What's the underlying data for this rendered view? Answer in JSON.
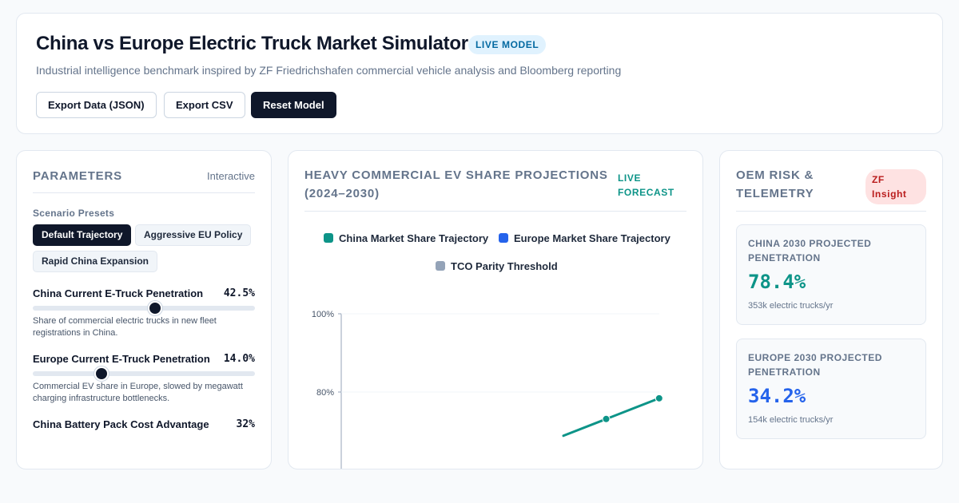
{
  "header": {
    "title": "China vs Europe Electric Truck Market Simulator",
    "badge": "LIVE MODEL",
    "subtitle": "Industrial intelligence benchmark inspired by ZF Friedrichshafen commercial vehicle analysis and Bloomberg reporting",
    "buttons": {
      "export_json": "Export Data (JSON)",
      "export_csv": "Export CSV",
      "reset": "Reset Model"
    }
  },
  "parameters": {
    "title": "Parameters",
    "mode": "Interactive",
    "presets_label": "Scenario Presets",
    "presets": [
      "Default Trajectory",
      "Aggressive EU Policy",
      "Rapid China Expansion"
    ],
    "active_preset": "Default Trajectory",
    "items": [
      {
        "label": "China Current E-Truck Penetration",
        "value": "42.5%",
        "level": 0.55,
        "description": "Share of commercial electric trucks in new fleet registrations in China."
      },
      {
        "label": "Europe Current E-Truck Penetration",
        "value": "14.0%",
        "level": 0.31,
        "description": "Commercial EV share in Europe, slowed by megawatt charging infrastructure bottlenecks."
      },
      {
        "label": "China Battery Pack Cost Advantage",
        "value": "32%"
      }
    ]
  },
  "chart_panel": {
    "title": "Heavy Commercial EV Share Projections (2024–2030)",
    "badge": "LIVE FORECAST"
  },
  "chart_data": {
    "type": "line",
    "title": "Heavy Commercial EV Share Projections (2024–2030)",
    "legend": [
      "China Market Share Trajectory",
      "Europe Market Share Trajectory",
      "TCO Parity Threshold"
    ],
    "legend_placement": "top",
    "y_ticks": [
      "100%",
      "80%"
    ],
    "ylim": [
      0,
      100
    ],
    "grid": true,
    "colors": {
      "china": "#0d9488",
      "europe": "#2563eb",
      "tco": "#94a3b8"
    },
    "series": [
      {
        "name": "China Market Share Trajectory",
        "visible_points": [
          {
            "index": 5,
            "y": 73.1
          },
          {
            "index": 6,
            "y": 78.4
          }
        ]
      }
    ]
  },
  "risk_panel": {
    "title": "OEM Risk & Telemetry",
    "badge": "ZF Insight",
    "stats": [
      {
        "label": "China 2030 Projected Penetration",
        "value": "78.4%",
        "sub": "353k electric trucks/yr",
        "color": "#0d9488"
      },
      {
        "label": "Europe 2030 Projected Penetration",
        "value": "34.2%",
        "sub": "154k electric trucks/yr",
        "color": "#2563eb"
      }
    ]
  }
}
